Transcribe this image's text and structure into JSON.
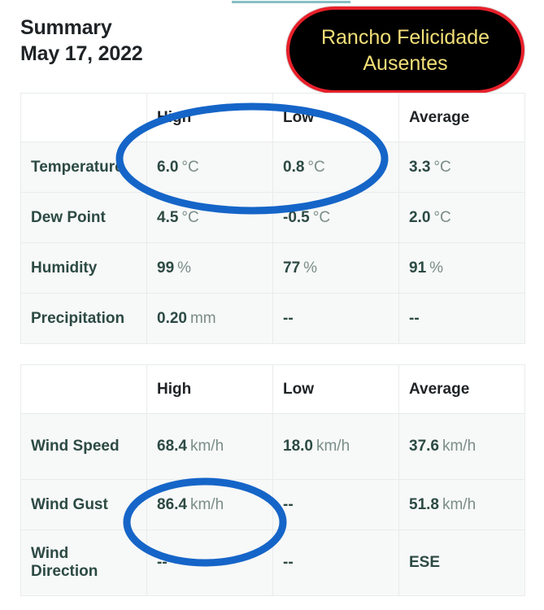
{
  "header": {
    "title": "Summary",
    "date": "May 17, 2022"
  },
  "badge": {
    "line1": "Rancho Felicidade",
    "line2": "Ausentes",
    "background_color": "#000000",
    "border_color": "#e8202a",
    "text_color": "#f2df78"
  },
  "annotations": {
    "highlight_color": "#1565c8",
    "ellipse1_target": "Temperature High and Low values",
    "ellipse2_target": "Wind Gust High value"
  },
  "tables": [
    {
      "name": "conditions-table",
      "columns": [
        "",
        "High",
        "Low",
        "Average"
      ],
      "rows": [
        {
          "label": "Temperature",
          "cells": [
            {
              "value": "6.0",
              "unit": "°C"
            },
            {
              "value": "0.8",
              "unit": "°C"
            },
            {
              "value": "3.3",
              "unit": "°C"
            }
          ]
        },
        {
          "label": "Dew Point",
          "cells": [
            {
              "value": "4.5",
              "unit": "°C"
            },
            {
              "value": "-0.5",
              "unit": "°C"
            },
            {
              "value": "2.0",
              "unit": "°C"
            }
          ]
        },
        {
          "label": "Humidity",
          "cells": [
            {
              "value": "99",
              "unit": "%"
            },
            {
              "value": "77",
              "unit": "%"
            },
            {
              "value": "91",
              "unit": "%"
            }
          ]
        },
        {
          "label": "Precipitation",
          "cells": [
            {
              "value": "0.20",
              "unit": "mm"
            },
            {
              "value": "--",
              "unit": ""
            },
            {
              "value": "--",
              "unit": ""
            }
          ]
        }
      ]
    },
    {
      "name": "wind-table",
      "columns": [
        "",
        "High",
        "Low",
        "Average"
      ],
      "rows": [
        {
          "label": "Wind Speed",
          "cells": [
            {
              "value": "68.4",
              "unit": "km/h"
            },
            {
              "value": "18.0",
              "unit": "km/h"
            },
            {
              "value": "37.6",
              "unit": "km/h"
            }
          ]
        },
        {
          "label": "Wind Gust",
          "cells": [
            {
              "value": "86.4",
              "unit": "km/h"
            },
            {
              "value": "--",
              "unit": ""
            },
            {
              "value": "51.8",
              "unit": "km/h"
            }
          ]
        },
        {
          "label": "Wind Direction",
          "cells": [
            {
              "value": "--",
              "unit": ""
            },
            {
              "value": "--",
              "unit": ""
            },
            {
              "value": "ESE",
              "unit": ""
            }
          ]
        }
      ]
    }
  ]
}
